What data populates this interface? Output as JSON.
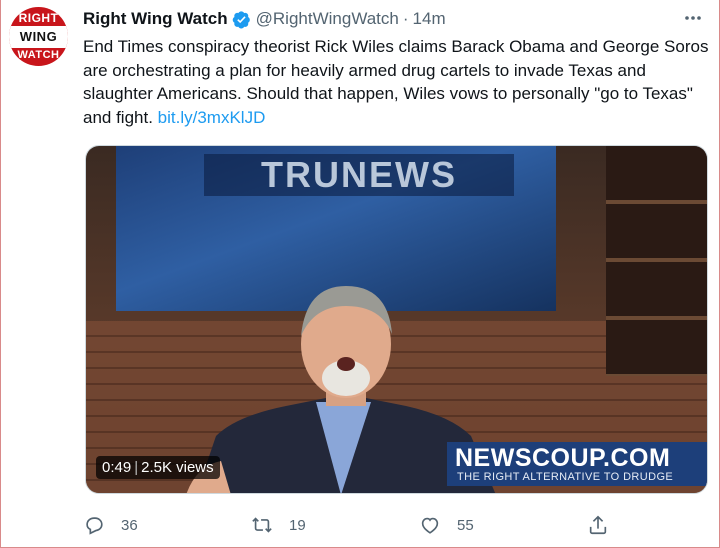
{
  "account": {
    "avatar_text": [
      "RIGHT",
      "WING",
      "WATCH"
    ],
    "name": "Right Wing Watch",
    "handle": "@RightWingWatch",
    "separator": "·",
    "time": "14m"
  },
  "tweet": {
    "text": "End Times conspiracy theorist Rick Wiles claims Barack Obama and George Soros are orchestrating a plan for heavily armed drug cartels to invade Texas and slaughter Americans. Should that happen, Wiles vows to personally \"go to Texas\" and fight. ",
    "link": "bit.ly/3mxKlJD"
  },
  "media": {
    "screen_brand": "TRUNEWS",
    "ad_main": "NEWSCOUP.COM",
    "ad_sub": "THE RIGHT ALTERNATIVE TO DRUDGE",
    "duration": "0:49",
    "views": "2.5K views"
  },
  "actions": {
    "replies": "36",
    "retweets": "19",
    "likes": "55"
  },
  "colors": {
    "accent": "#1d9bf0",
    "muted": "#536471",
    "avatar_red": "#c8151b"
  },
  "icons": [
    "verified-badge-icon",
    "more-icon",
    "reply-icon",
    "retweet-icon",
    "like-icon",
    "share-icon"
  ]
}
